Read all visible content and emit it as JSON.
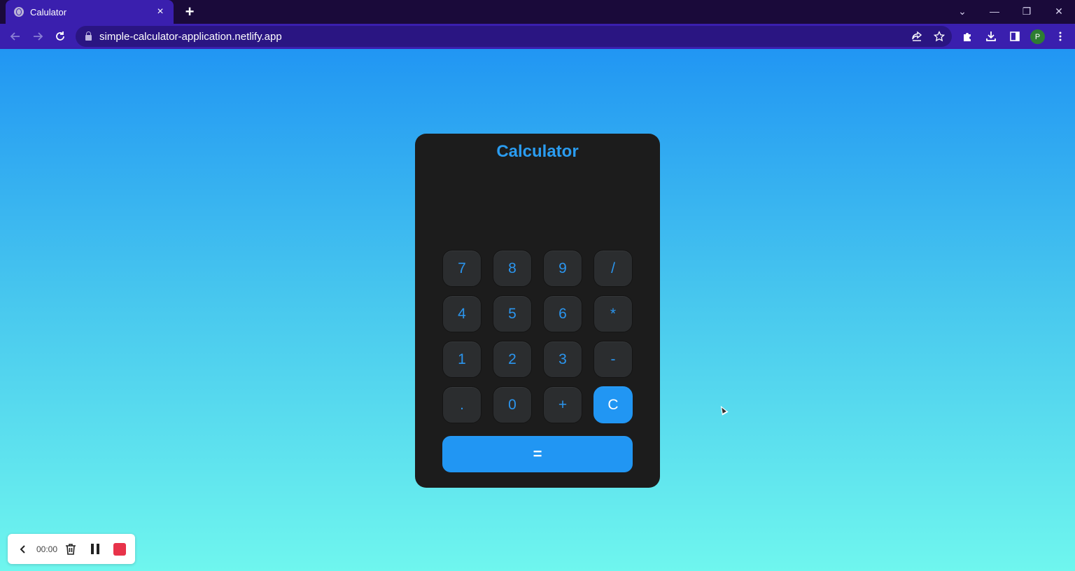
{
  "browser": {
    "tab_title": "Calulator",
    "tab_close": "×",
    "new_tab": "+",
    "url": "simple-calculator-application.netlify.app",
    "profile_initial": "P",
    "controls": {
      "dropdown": "⌄",
      "minimize": "—",
      "restore": "❐",
      "close": "✕"
    }
  },
  "calculator": {
    "title": "Calculator",
    "display": "",
    "keys": [
      [
        "7",
        "8",
        "9",
        "/"
      ],
      [
        "4",
        "5",
        "6",
        "*"
      ],
      [
        "1",
        "2",
        "3",
        "-"
      ],
      [
        ".",
        "0",
        "+",
        "C"
      ]
    ],
    "equals": "="
  },
  "recorder": {
    "time": "00:00"
  },
  "colors": {
    "accent": "#2196f3",
    "card": "#1c1c1c",
    "key": "#2b2d2f",
    "tab": "#3a1fae",
    "stop": "#e8334a"
  },
  "icons": {
    "back": "arrow-left-icon",
    "forward": "arrow-right-icon",
    "reload": "reload-icon",
    "share": "share-icon",
    "bookmark": "star-icon",
    "extensions": "puzzle-icon",
    "download": "download-icon",
    "sidepanel": "side-panel-icon",
    "menu": "kebab-menu-icon",
    "recorder_back": "chevron-left-icon",
    "recorder_delete": "trash-icon",
    "recorder_pause": "pause-icon",
    "recorder_stop": "stop-icon"
  }
}
